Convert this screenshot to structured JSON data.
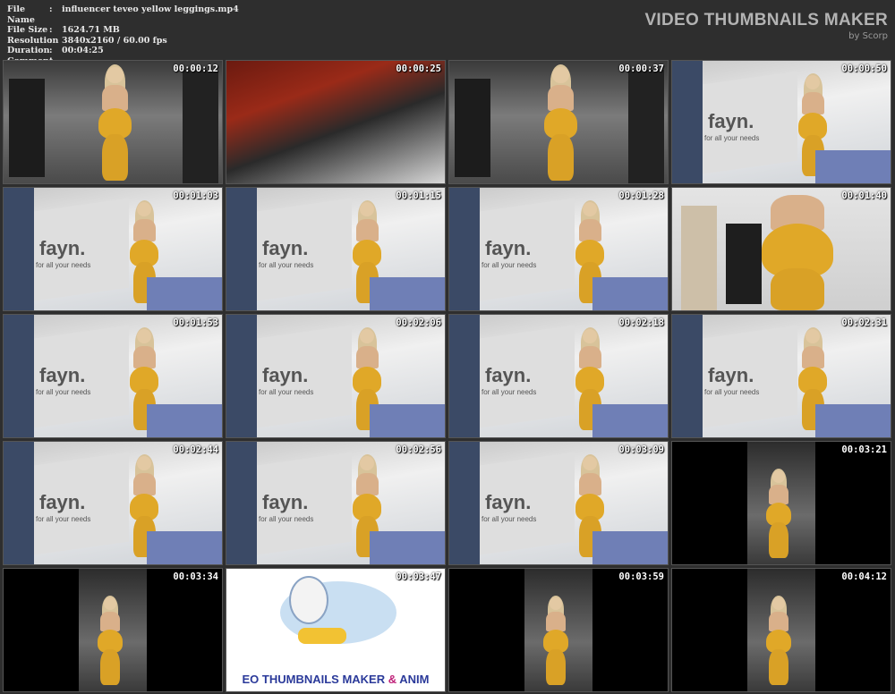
{
  "info": [
    {
      "key": "File Name",
      "value": "influencer teveo yellow leggings.mp4"
    },
    {
      "key": "File Size",
      "value": "1624.71 MB"
    },
    {
      "key": "Resolution",
      "value": "3840x2160 / 60.00 fps"
    },
    {
      "key": "Duration",
      "value": "00:04:25"
    },
    {
      "key": "Comment",
      "value": ""
    }
  ],
  "brand": {
    "title": "VIDEO THUMBNAILS MAKER",
    "subtitle": "by Scorp"
  },
  "thumbs": [
    {
      "time": "00:00:12",
      "scene": "crowd"
    },
    {
      "time": "00:00:25",
      "scene": "blur"
    },
    {
      "time": "00:00:37",
      "scene": "crowd"
    },
    {
      "time": "00:00:50",
      "scene": "booth"
    },
    {
      "time": "00:01:03",
      "scene": "booth"
    },
    {
      "time": "00:01:15",
      "scene": "booth"
    },
    {
      "time": "00:01:28",
      "scene": "booth"
    },
    {
      "time": "00:01:40",
      "scene": "closeup"
    },
    {
      "time": "00:01:53",
      "scene": "booth"
    },
    {
      "time": "00:02:06",
      "scene": "booth"
    },
    {
      "time": "00:02:18",
      "scene": "booth"
    },
    {
      "time": "00:02:31",
      "scene": "booth"
    },
    {
      "time": "00:02:44",
      "scene": "booth"
    },
    {
      "time": "00:02:56",
      "scene": "booth"
    },
    {
      "time": "00:03:09",
      "scene": "booth"
    },
    {
      "time": "00:03:21",
      "scene": "vertical"
    },
    {
      "time": "00:03:34",
      "scene": "vertical"
    },
    {
      "time": "00:03:47",
      "scene": "logo"
    },
    {
      "time": "00:03:59",
      "scene": "vertical"
    },
    {
      "time": "00:04:12",
      "scene": "vertical"
    }
  ],
  "booth_text": {
    "brand": "fayn.",
    "tagline": "for all your needs"
  },
  "logo_text": {
    "main": "EO THUMBNAILS MAKER ",
    "amp": "&",
    "tail": " ANIM"
  }
}
